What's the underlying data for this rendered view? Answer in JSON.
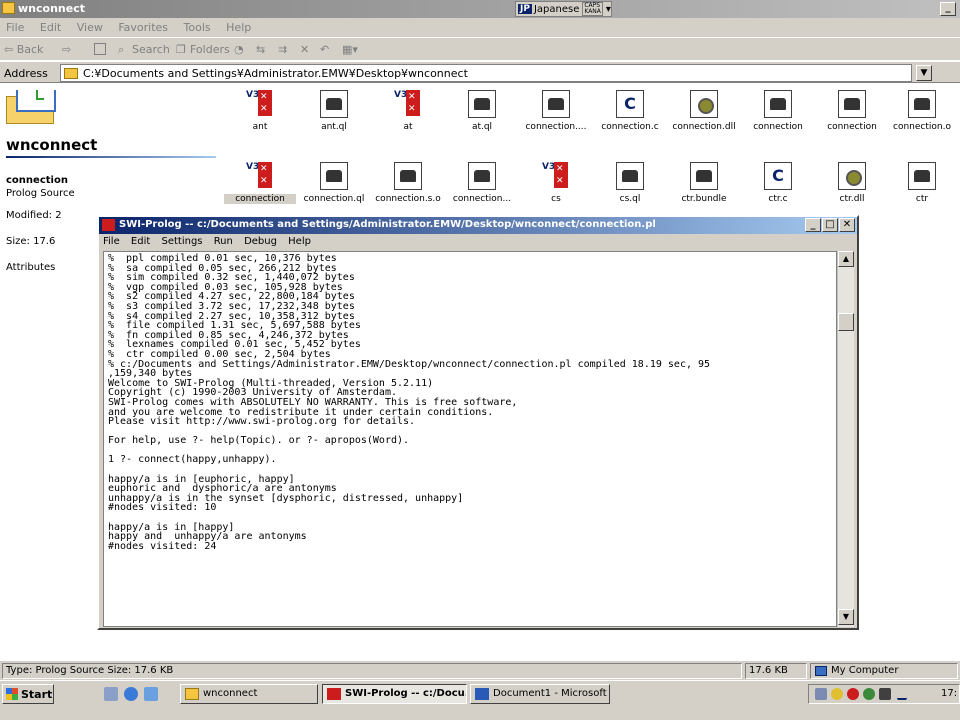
{
  "window": {
    "title": "wnconnect",
    "minimize_label": "_"
  },
  "ime": {
    "lang_code": "JP",
    "lang_label": "Japanese",
    "caps": "CAPS",
    "kana": "KANA"
  },
  "menu": {
    "items": [
      "File",
      "Edit",
      "View",
      "Favorites",
      "Tools",
      "Help"
    ]
  },
  "toolbar": {
    "back": "⇦ Back",
    "forward": "⇨",
    "search": "Search",
    "folders": "Folders"
  },
  "address": {
    "label": "Address",
    "value": "C:¥Documents and Settings¥Administrator.EMW¥Desktop¥wnconnect"
  },
  "left_panel": {
    "folder_name": "wnconnect",
    "selected_name": "connection",
    "selected_type": "Prolog Source",
    "modified": "Modified: 2",
    "size": "Size: 17.6",
    "attributes": "Attributes"
  },
  "files": [
    {
      "name": "ant",
      "icon": "binary-icon"
    },
    {
      "name": "ant.ql",
      "icon": "prolog-icon"
    },
    {
      "name": "at",
      "icon": "binary-icon"
    },
    {
      "name": "at.ql",
      "icon": "prolog-icon"
    },
    {
      "name": "connection....",
      "icon": "prolog-icon"
    },
    {
      "name": "connection.c",
      "icon": "c-file-icon"
    },
    {
      "name": "connection.dll",
      "icon": "dll-icon"
    },
    {
      "name": "connection",
      "icon": "prolog-icon"
    },
    {
      "name": "connection",
      "icon": "prolog-icon"
    },
    {
      "name": "connection.o",
      "icon": "prolog-icon"
    },
    {
      "name": "connection",
      "icon": "binary-icon",
      "selected": true
    },
    {
      "name": "connection.ql",
      "icon": "prolog-icon"
    },
    {
      "name": "connection.s.o",
      "icon": "prolog-icon"
    },
    {
      "name": "connection...",
      "icon": "prolog-icon"
    },
    {
      "name": "cs",
      "icon": "binary-icon"
    },
    {
      "name": "cs.ql",
      "icon": "prolog-icon"
    },
    {
      "name": "ctr.bundle",
      "icon": "prolog-icon"
    },
    {
      "name": "ctr.c",
      "icon": "c-file-icon"
    },
    {
      "name": "ctr.dll",
      "icon": "dll-icon"
    },
    {
      "name": "ctr",
      "icon": "prolog-icon"
    }
  ],
  "prolog": {
    "title": "SWI-Prolog -- c:/Documents and Settings/Administrator.EMW/Desktop/wnconnect/connection.pl",
    "menu": [
      "File",
      "Edit",
      "Settings",
      "Run",
      "Debug",
      "Help"
    ],
    "console_lines": [
      "%  ppl compiled 0.01 sec, 10,376 bytes",
      "%  sa compiled 0.05 sec, 266,212 bytes",
      "%  sim compiled 0.32 sec, 1,440,072 bytes",
      "%  vgp compiled 0.03 sec, 105,928 bytes",
      "%  s2 compiled 4.27 sec, 22,800,184 bytes",
      "%  s3 compiled 3.72 sec, 17,232,348 bytes",
      "%  s4 compiled 2.27 sec, 10,358,312 bytes",
      "%  file compiled 1.31 sec, 5,697,588 bytes",
      "%  fn compiled 0.85 sec, 4,246,372 bytes",
      "%  lexnames compiled 0.01 sec, 5,452 bytes",
      "%  ctr compiled 0.00 sec, 2,504 bytes",
      "% c:/Documents and Settings/Administrator.EMW/Desktop/wnconnect/connection.pl compiled 18.19 sec, 95",
      ",159,340 bytes",
      "Welcome to SWI-Prolog (Multi-threaded, Version 5.2.11)",
      "Copyright (c) 1990-2003 University of Amsterdam.",
      "SWI-Prolog comes with ABSOLUTELY NO WARRANTY. This is free software,",
      "and you are welcome to redistribute it under certain conditions.",
      "Please visit http://www.swi-prolog.org for details.",
      "",
      "For help, use ?- help(Topic). or ?- apropos(Word).",
      "",
      "1 ?- connect(happy,unhappy).",
      "",
      "happy/a is in [euphoric, happy]",
      "euphoric and  dysphoric/a are antonyms",
      "unhappy/a is in the synset [dysphoric, distressed, unhappy]",
      "#nodes visited: 10",
      "",
      "happy/a is in [happy]",
      "happy and  unhappy/a are antonyms",
      "#nodes visited: 24"
    ]
  },
  "status": {
    "left": "Type: Prolog Source Size: 17.6 KB",
    "size": "17.6 KB",
    "zone": "My Computer"
  },
  "taskbar": {
    "start": "Start",
    "buttons": [
      {
        "label": "wnconnect",
        "active": false
      },
      {
        "label": "SWI-Prolog -- c:/Docu...",
        "active": true
      },
      {
        "label": "Document1 - Microsoft W...",
        "active": false
      }
    ],
    "clock": "17:"
  },
  "colors": {
    "title_active": "#0a246a",
    "title_inactive": "#808080",
    "face": "#d4d0c8",
    "prolog_red": "#cc1c1c"
  }
}
